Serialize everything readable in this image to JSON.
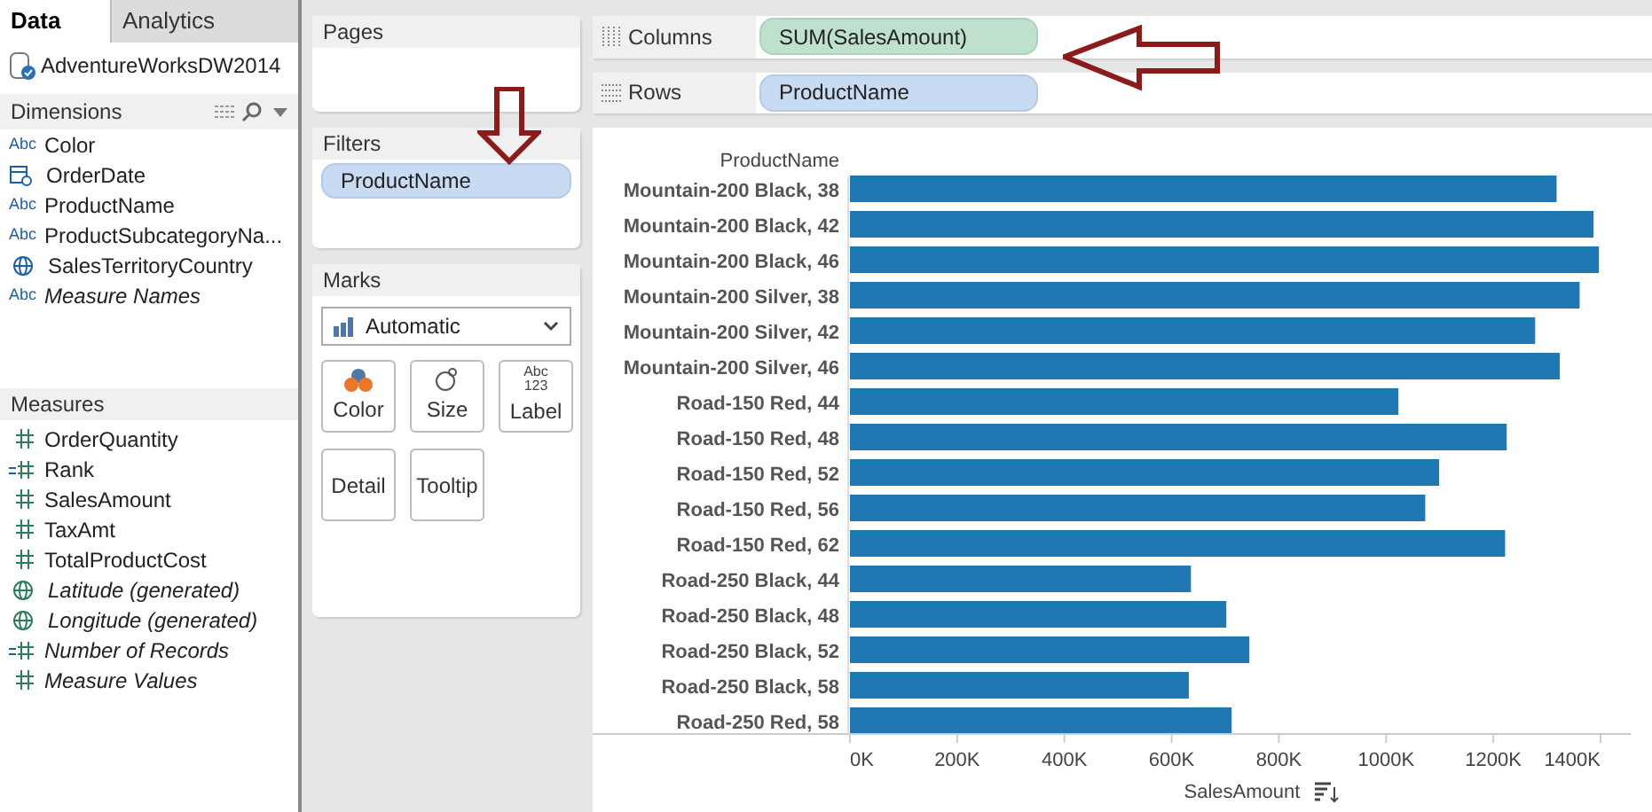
{
  "tabs": [
    {
      "label": "Data",
      "selected": true
    },
    {
      "label": "Analytics",
      "selected": false
    }
  ],
  "data_source": "AdventureWorksDW2014",
  "dimensions": {
    "title": "Dimensions",
    "fields": [
      {
        "kind": "string",
        "badge": "Abc",
        "name": "Color",
        "italic": false
      },
      {
        "kind": "date",
        "name": "OrderDate",
        "italic": false
      },
      {
        "kind": "string",
        "badge": "Abc",
        "name": "ProductName",
        "italic": false
      },
      {
        "kind": "string",
        "badge": "Abc",
        "name": "ProductSubcategoryNa...",
        "italic": false
      },
      {
        "kind": "geo",
        "name": "SalesTerritoryCountry",
        "italic": false
      },
      {
        "kind": "string",
        "badge": "Abc",
        "name": "Measure Names",
        "italic": true
      }
    ]
  },
  "measures": {
    "title": "Measures",
    "fields": [
      {
        "kind": "measure",
        "name": "OrderQuantity",
        "italic": false
      },
      {
        "kind": "calc",
        "name": "Rank",
        "italic": false
      },
      {
        "kind": "measure",
        "name": "SalesAmount",
        "italic": false
      },
      {
        "kind": "measure",
        "name": "TaxAmt",
        "italic": false
      },
      {
        "kind": "measure",
        "name": "TotalProductCost",
        "italic": false
      },
      {
        "kind": "geo",
        "name": "Latitude (generated)",
        "italic": true
      },
      {
        "kind": "geo",
        "name": "Longitude (generated)",
        "italic": true
      },
      {
        "kind": "calc",
        "name": "Number of Records",
        "italic": true
      },
      {
        "kind": "measure",
        "name": "Measure Values",
        "italic": true
      }
    ]
  },
  "pages": {
    "title": "Pages"
  },
  "filters": {
    "title": "Filters",
    "pills": [
      "ProductName"
    ]
  },
  "marks": {
    "title": "Marks",
    "type": "Automatic",
    "buttons": [
      {
        "kind": "color",
        "label": "Color"
      },
      {
        "kind": "size",
        "label": "Size"
      },
      {
        "kind": "label",
        "label": "Label",
        "icon_text": [
          "Abc",
          "123"
        ]
      },
      {
        "kind": "detail",
        "label": "Detail"
      },
      {
        "kind": "tooltip",
        "label": "Tooltip"
      }
    ]
  },
  "shelves": [
    {
      "kind": "columns",
      "label": "Columns",
      "pill": "SUM(SalesAmount)"
    },
    {
      "kind": "rows",
      "label": "Rows",
      "pill": "ProductName"
    }
  ],
  "chart": {
    "chart_data": {
      "type": "bar",
      "orientation": "horizontal",
      "xlabel": "SalesAmount",
      "ylabel": "ProductName",
      "categories": [
        "Mountain-200 Black, 38",
        "Mountain-200 Black, 42",
        "Mountain-200 Black, 46",
        "Mountain-200 Silver, 38",
        "Mountain-200 Silver, 42",
        "Mountain-200 Silver, 46",
        "Road-150 Red, 44",
        "Road-150 Red, 48",
        "Road-150 Red, 52",
        "Road-150 Red, 56",
        "Road-150 Red, 62",
        "Road-250 Black, 44",
        "Road-250 Black, 48",
        "Road-250 Black, 52",
        "Road-250 Black, 58",
        "Road-250 Red, 58"
      ],
      "series": [
        {
          "color": "#1f77b4",
          "values": [
            1318000,
            1387000,
            1397000,
            1361000,
            1278000,
            1324000,
            1023000,
            1225000,
            1099000,
            1073000,
            1222000,
            636000,
            702000,
            745000,
            632000,
            712000
          ]
        }
      ],
      "xlim": [
        0,
        1400000
      ],
      "xticks": [
        {
          "value": 0,
          "label": "0K"
        },
        {
          "value": 200000,
          "label": "200K"
        },
        {
          "value": 400000,
          "label": "400K"
        },
        {
          "value": 600000,
          "label": "600K"
        },
        {
          "value": 800000,
          "label": "800K"
        },
        {
          "value": 1000000,
          "label": "1000K"
        },
        {
          "value": 1200000,
          "label": "1200K"
        },
        {
          "value": 1400000,
          "label": "1400K"
        }
      ]
    }
  }
}
